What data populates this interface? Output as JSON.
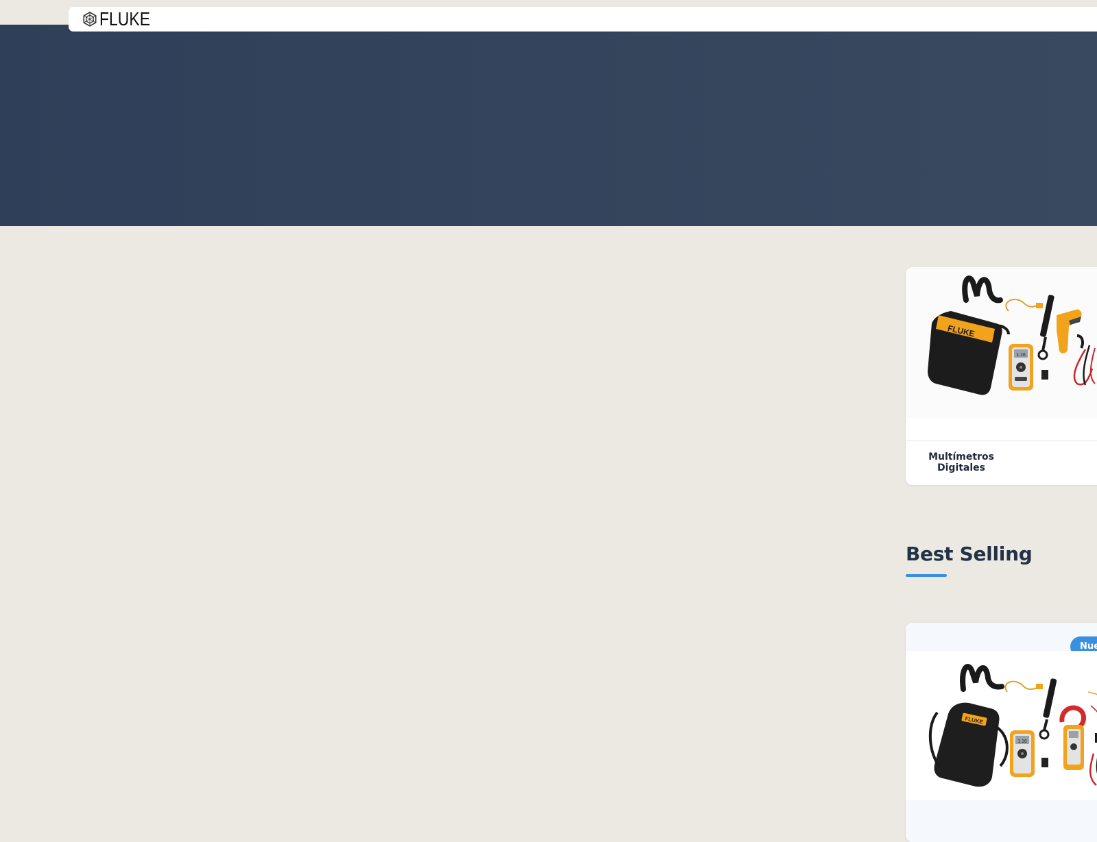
{
  "header": {
    "brand": "FLUKE",
    "logo_icon": "fluke-hexagon-icon"
  },
  "colors": {
    "hero_bg": "#34445C",
    "page_bg": "#ECE9E3",
    "accent": "#3B8FE0",
    "heading": "#233246"
  },
  "categories": [
    {
      "title": "Multímetros Digitales",
      "image": "fluke-multimeter-kit-image"
    }
  ],
  "best_selling": {
    "title": "Best Selling",
    "products": [
      {
        "badge": "Nuev",
        "image": "fluke-multimeter-clamp-kit-image"
      }
    ]
  }
}
